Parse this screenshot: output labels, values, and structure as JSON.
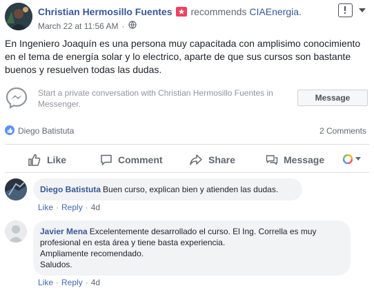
{
  "post": {
    "author": "Christian Hermosillo Fuentes",
    "verb": "recommends",
    "page": "CIAEnergia.",
    "timestamp": "March 22 at 11:56 AM",
    "dot": "·",
    "audience_icon": "globe-icon",
    "text": "En Ingeniero Joaquín es una persona muy capacitada con amplisimo conocimiento en el tema de energía solar y lo electrico, aparte de que sus cursos son bastante buenos y resuelven todas las dudas."
  },
  "messenger": {
    "prompt": "Start a private conversation with Christian Hermosillo Fuentes in Messenger.",
    "button_label": "Message"
  },
  "reactions": {
    "reactor": "Diego Batistuta",
    "comments_count": "2 Comments"
  },
  "actions": {
    "like": "Like",
    "comment": "Comment",
    "share": "Share",
    "message": "Message"
  },
  "comments": [
    {
      "author": "Diego Batistuta",
      "text": "Buen curso, explican bien y atienden las dudas.",
      "like": "Like",
      "reply": "Reply",
      "sep": "·",
      "age": "4d"
    },
    {
      "author": "Javier Mena",
      "text": "Excelentemente desarrollado el curso. El Ing. Corrella es muy profesional en esta área y tiene basta experiencia.",
      "line2": "Ampliamente recomendado.",
      "line3": "Saludos.",
      "like": "Like",
      "reply": "Reply",
      "sep": "·",
      "age": "4d"
    }
  ],
  "colors": {
    "link": "#365899",
    "recommend_badge": "#f23f5f",
    "like_blue": "#5890ff",
    "bubble_bg": "#f2f3f5"
  }
}
